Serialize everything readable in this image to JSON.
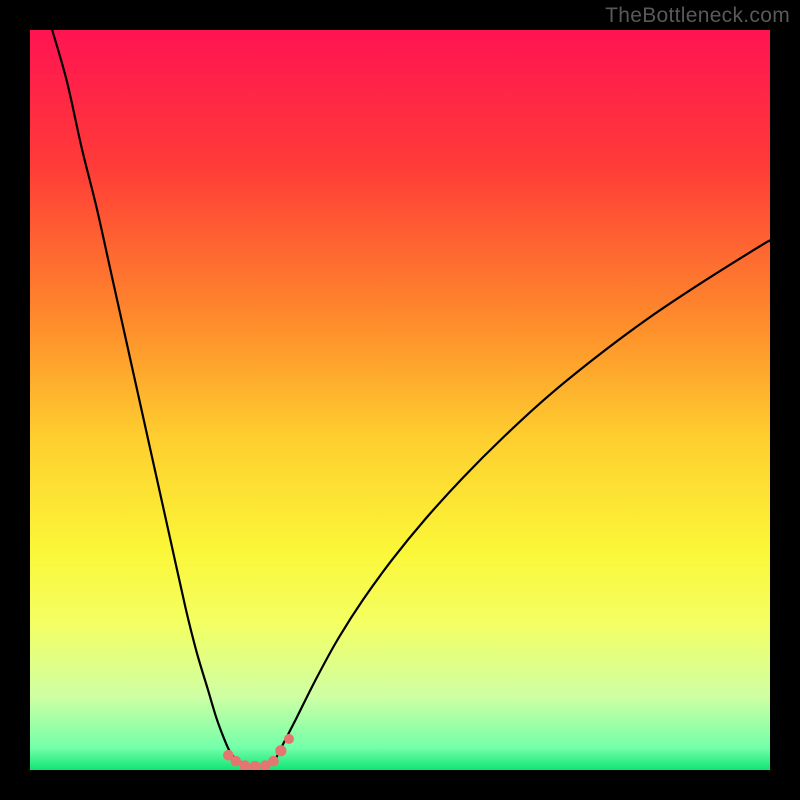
{
  "watermark": "TheBottleneck.com",
  "chart_data": {
    "type": "line",
    "title": "",
    "xlabel": "",
    "ylabel": "",
    "xlim": [
      0,
      100
    ],
    "ylim": [
      0,
      100
    ],
    "gradient_stops": [
      {
        "offset": 0,
        "color": "#ff1452"
      },
      {
        "offset": 0.18,
        "color": "#ff3a38"
      },
      {
        "offset": 0.4,
        "color": "#fe8e2b"
      },
      {
        "offset": 0.55,
        "color": "#fece2f"
      },
      {
        "offset": 0.7,
        "color": "#fbf637"
      },
      {
        "offset": 0.8,
        "color": "#f4ff62"
      },
      {
        "offset": 0.9,
        "color": "#cfffa4"
      },
      {
        "offset": 0.97,
        "color": "#73ffa9"
      },
      {
        "offset": 1.0,
        "color": "#10e574"
      }
    ],
    "series": [
      {
        "name": "left-arm",
        "x": [
          3,
          5,
          7,
          9,
          11,
          13,
          15,
          17,
          19,
          21,
          22.5,
          24,
          25.2,
          26.2,
          27,
          27.6
        ],
        "y": [
          100,
          93,
          84,
          76,
          67,
          58,
          49,
          40,
          31,
          22,
          16,
          11,
          7,
          4.3,
          2.5,
          1.7
        ]
      },
      {
        "name": "right-arm",
        "x": [
          33.3,
          34.2,
          36,
          38.5,
          41.5,
          45,
          49,
          53.5,
          58.5,
          64,
          70,
          76.5,
          83.5,
          91,
          99,
          100
        ],
        "y": [
          1.7,
          3.5,
          7,
          12,
          17.5,
          23,
          28.5,
          34,
          39.5,
          45,
          50.5,
          55.8,
          61,
          66,
          71,
          71.5
        ]
      },
      {
        "name": "trough",
        "x": [
          27.6,
          28.4,
          29.5,
          30.5,
          31.4,
          32.3,
          33.3
        ],
        "y": [
          1.7,
          1.1,
          0.55,
          0.4,
          0.55,
          1.1,
          1.7
        ]
      }
    ],
    "markers": {
      "color": "#e4766f",
      "x": [
        26.8,
        27.8,
        29.0,
        30.4,
        31.8,
        32.9,
        33.9,
        35.0
      ],
      "y": [
        2.0,
        1.2,
        0.6,
        0.45,
        0.6,
        1.2,
        2.6,
        4.2
      ],
      "r": [
        5.3,
        5.3,
        5.3,
        5.8,
        5.3,
        5.3,
        5.6,
        5.0
      ]
    }
  }
}
